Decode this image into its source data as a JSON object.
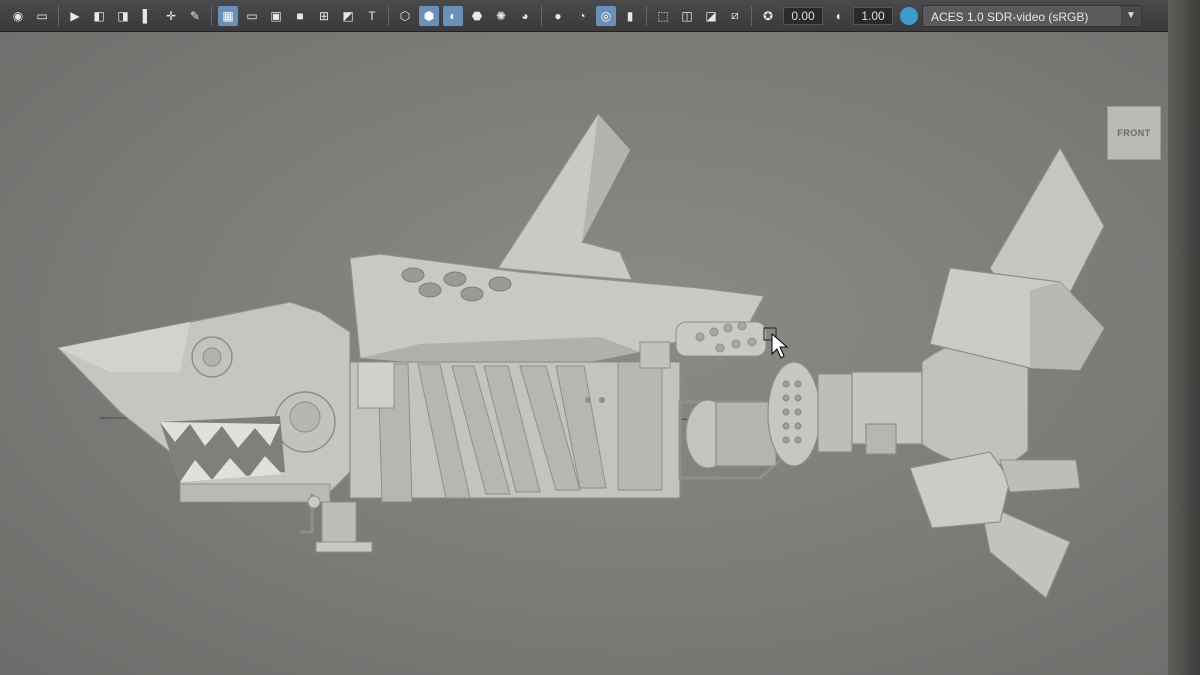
{
  "toolbar": {
    "exposure_value": "0.00",
    "gamma_value": "1.00",
    "color_space": "ACES 1.0 SDR-video (sRGB)"
  },
  "viewport": {
    "view_cube_label": "FRONT"
  },
  "colors": {
    "toolbar_bg": "#404042",
    "viewport_bg": "#7b7b78",
    "model_shade": "#c4c4c0",
    "active_icon": "#6a8fb8"
  }
}
